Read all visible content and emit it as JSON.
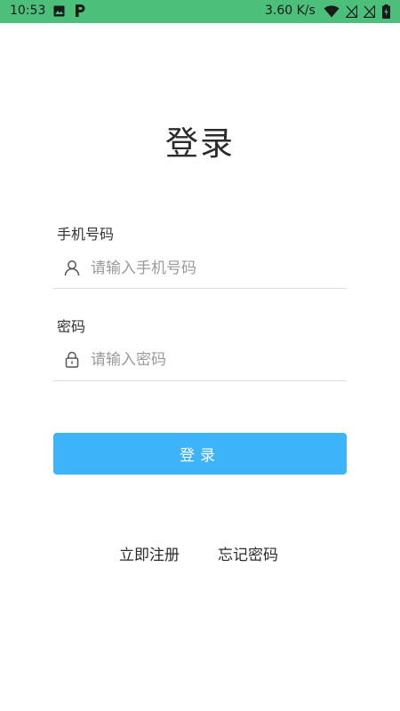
{
  "status_bar": {
    "time": "10:53",
    "network_speed": "3.60 K/s",
    "icons": [
      "image-icon",
      "p-app-icon",
      "wifi-icon",
      "sim-no-signal-icon",
      "sim-no-signal-icon",
      "battery-charging-icon"
    ],
    "background_color": "#4CBF7A"
  },
  "page": {
    "title": "登录"
  },
  "form": {
    "phone": {
      "label": "手机号码",
      "placeholder": "请输入手机号码",
      "value": "",
      "icon": "user-icon"
    },
    "password": {
      "label": "密码",
      "placeholder": "请输入密码",
      "value": "",
      "icon": "lock-icon"
    },
    "submit_label": "登录"
  },
  "links": {
    "register": "立即注册",
    "forgot_password": "忘记密码"
  },
  "colors": {
    "accent": "#3DB4FA",
    "divider": "#dcdcdc"
  }
}
